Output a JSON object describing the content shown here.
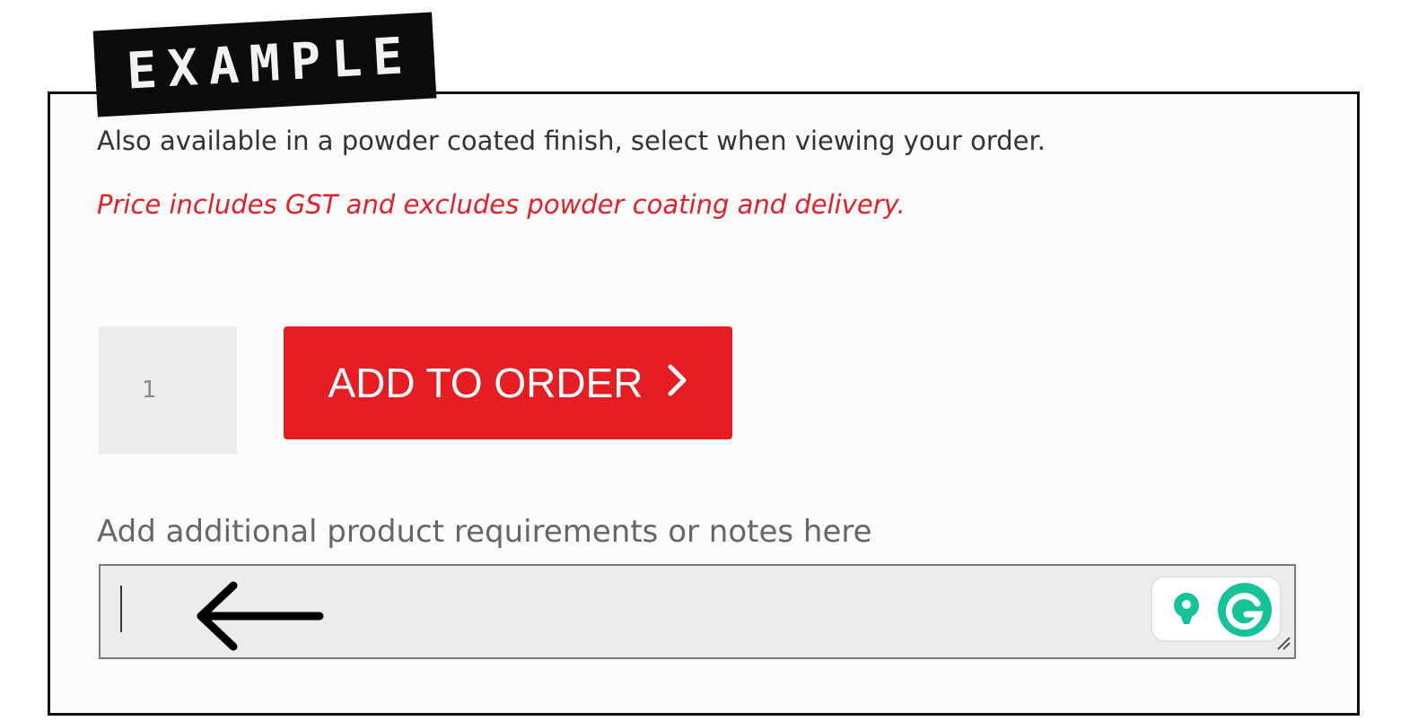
{
  "stamp": {
    "text": "EXAMPLE"
  },
  "product": {
    "finish_note": "Also available in a powder coated finish, select when viewing your order.",
    "price_note": "Price includes GST and excludes powder coating and delivery."
  },
  "order": {
    "quantity": "1",
    "add_button_label": "ADD TO ORDER",
    "add_button_chevron": "›"
  },
  "notes": {
    "label": "Add additional product requirements or notes here",
    "value": ""
  },
  "icons": {
    "arrow": "left-arrow-icon",
    "assistant": "lightbulb-icon",
    "grammarly": "grammarly-icon",
    "resize": "resize-handle-icon"
  },
  "colors": {
    "accent": "#e71d24",
    "price_text": "#e3202a",
    "grammarly_green": "#15c39a"
  }
}
